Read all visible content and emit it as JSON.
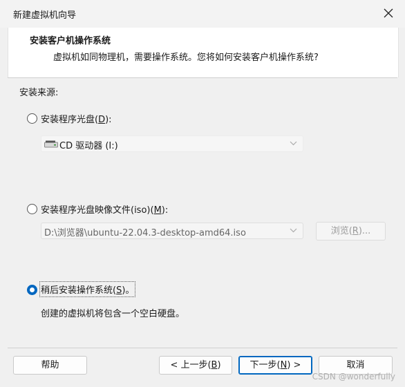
{
  "window": {
    "title": "新建虚拟机向导"
  },
  "header": {
    "title": "安装客户机操作系统",
    "subtitle": "虚拟机如同物理机，需要操作系统。您将如何安装客户机操作系统?"
  },
  "source_label": "安装来源:",
  "options": {
    "disc": {
      "label_pre": "安装程序光盘(",
      "accel": "D",
      "label_post": "):",
      "checked": false
    },
    "drive_select": {
      "value": "CD 驱动器 (I:)",
      "icon": "cd-drive-icon"
    },
    "iso": {
      "label_pre": "安装程序光盘映像文件(iso)(",
      "accel": "M",
      "label_post": "):",
      "checked": false
    },
    "iso_path": {
      "value": "D:\\浏览器\\ubuntu-22.04.3-desktop-amd64.iso"
    },
    "browse": {
      "label_pre": "浏览(",
      "accel": "R",
      "label_post": ")..."
    },
    "later": {
      "label_pre": "稍后安装操作系统(",
      "accel": "S",
      "label_post": ")。",
      "checked": true
    },
    "later_desc": "创建的虚拟机将包含一个空白硬盘。"
  },
  "footer": {
    "help": "帮助",
    "back": {
      "label_pre": "< 上一步(",
      "accel": "B",
      "label_post": ")"
    },
    "next": {
      "label_pre": "下一步(",
      "accel": "N",
      "label_post": ") >"
    },
    "cancel": "取消"
  },
  "watermark": "CSDN @wonderfully",
  "colors": {
    "accent": "#0067c0"
  }
}
